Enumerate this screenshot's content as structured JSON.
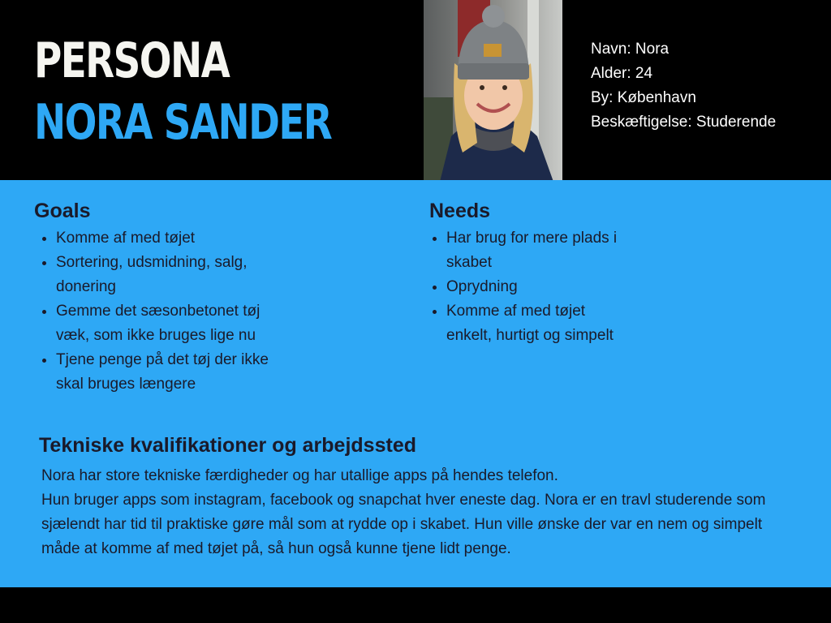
{
  "header": {
    "title_line1": "PERSONA",
    "title_line2": "NORA SANDER"
  },
  "info": [
    "Navn: Nora",
    "Alder: 24",
    "By: København",
    "Beskæftigelse: Studerende"
  ],
  "goals": {
    "title": "Goals",
    "items": [
      "Komme af med tøjet",
      "Sortering, udsmidning, salg, donering",
      "Gemme det sæsonbetonet tøj væk, som ikke bruges lige nu",
      "Tjene penge på det tøj der ikke skal bruges længere"
    ]
  },
  "needs": {
    "title": "Needs",
    "items": [
      "Har brug for mere plads i skabet",
      "Oprydning",
      "Komme af med tøjet enkelt, hurtigt og simpelt"
    ]
  },
  "tech": {
    "title": "Tekniske kvalifikationer og arbejdssted",
    "line1": "Nora har store tekniske færdigheder og har utallige apps på hendes telefon.",
    "line2": "Hun bruger apps som instagram, facebook og snapchat hver eneste dag. Nora er en travl studerende som sjælendt har tid til praktiske gøre mål som at rydde op i skabet. Hun ville ønske der var en nem og simpelt måde at komme af med tøjet på, så hun også kunne tjene lidt penge."
  },
  "colors": {
    "accent_blue": "#2ea8f5",
    "background_black": "#000000",
    "title_white": "#f5f5f0",
    "body_text": "#1a1a2a"
  },
  "icons": {
    "photo": "portrait-photo-woman-grey-beanie"
  }
}
